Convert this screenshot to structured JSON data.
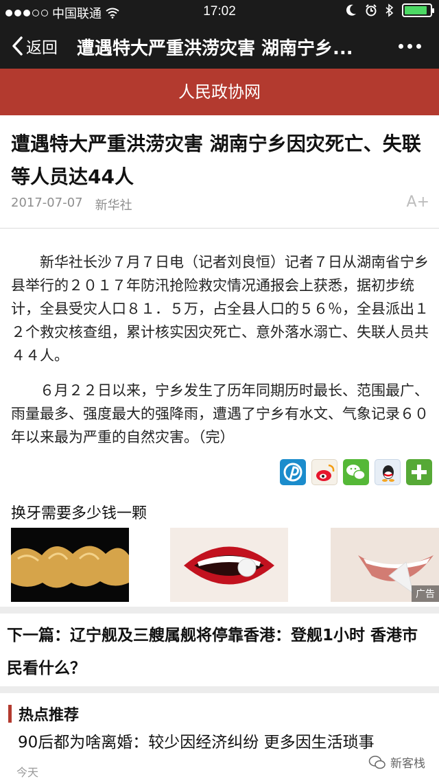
{
  "status_bar": {
    "carrier": "中国联通",
    "time": "17:02",
    "battery_level": 0.9
  },
  "nav": {
    "back_label": "返回",
    "title": "遭遇特大严重洪涝灾害 湖南宁乡..."
  },
  "site": {
    "name": "人民政协网"
  },
  "article": {
    "title": "遭遇特大严重洪涝灾害 湖南宁乡因灾死亡、失联等人员达44人",
    "date": "2017-07-07",
    "source": "新华社",
    "font_size_label": "A+",
    "paragraphs": [
      "新华社长沙７月７日电（记者刘良恒）记者７日从湖南省宁乡县举行的２０１７年防汛抢险救灾情况通报会上获悉，据初步统计，全县受灾人口８１．５万，占全县人口的５６％，全县派出１２个救灾核查组，累计核实因灾死亡、意外落水溺亡、失联人员共４４人。",
      "６月２２日以来，宁乡发生了历年同期历时最长、范围最广、雨量最多、强度最大的强降雨，遭遇了宁乡有水文、气象记录６０年以来最为严重的自然灾害。（完）"
    ]
  },
  "share_icons": [
    "pinterest-share-icon",
    "weibo-share-icon",
    "wechat-share-icon",
    "qq-share-icon",
    "more-share-icon"
  ],
  "ad": {
    "title": "换牙需要多少钱一颗",
    "badge": "广告"
  },
  "next_article": {
    "text": "下一篇：辽宁舰及三艘属舰将停靠香港：登舰1小时 香港市民看什么？"
  },
  "hot": {
    "heading": "热点推荐",
    "item": "90后都为啥离婚：较少因经济纠纷 更多因生活琐事",
    "time": "今天"
  },
  "watermark": {
    "text": "新客栈"
  },
  "colors": {
    "nav_bg": "#1b1b1b",
    "banner": "#b33a2f",
    "accent_bar": "#b33a2f"
  }
}
